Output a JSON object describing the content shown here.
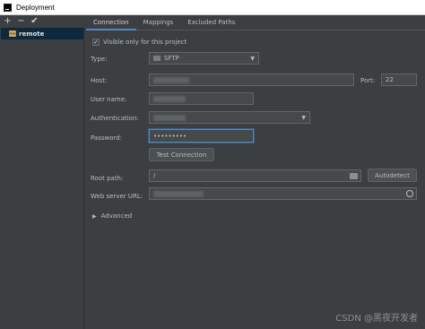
{
  "window": {
    "title": "Deployment"
  },
  "toolbar": {
    "add": "+",
    "remove": "−",
    "apply": "✔"
  },
  "sidebar": {
    "items": [
      {
        "label": "remote"
      }
    ]
  },
  "tabs": [
    {
      "label": "Connection"
    },
    {
      "label": "Mappings"
    },
    {
      "label": "Excluded Paths"
    }
  ],
  "form": {
    "visible_only": {
      "label": "Visible only for this project",
      "checked": true
    },
    "type": {
      "label": "Type:",
      "value": "SFTP"
    },
    "host": {
      "label": "Host:",
      "value": ""
    },
    "port": {
      "label": "Port:",
      "value": "22"
    },
    "user_name": {
      "label": "User name:",
      "value": ""
    },
    "authentication": {
      "label": "Authentication:",
      "value": ""
    },
    "password": {
      "label": "Password:",
      "value": "•••••••••"
    },
    "test_connection": {
      "label": "Test Connection"
    },
    "root_path": {
      "label": "Root path:",
      "value": "/"
    },
    "autodetect": {
      "label": "Autodetect"
    },
    "web_server_url": {
      "label": "Web server URL:",
      "value": ""
    },
    "advanced": {
      "label": "Advanced"
    }
  },
  "watermark": "CSDN @黑夜开发者",
  "icons": {
    "app": "pycharm-icon",
    "server": "sftp-server-icon",
    "folder": "folder-icon",
    "globe": "globe-icon",
    "expand": "chevron-right-icon"
  }
}
